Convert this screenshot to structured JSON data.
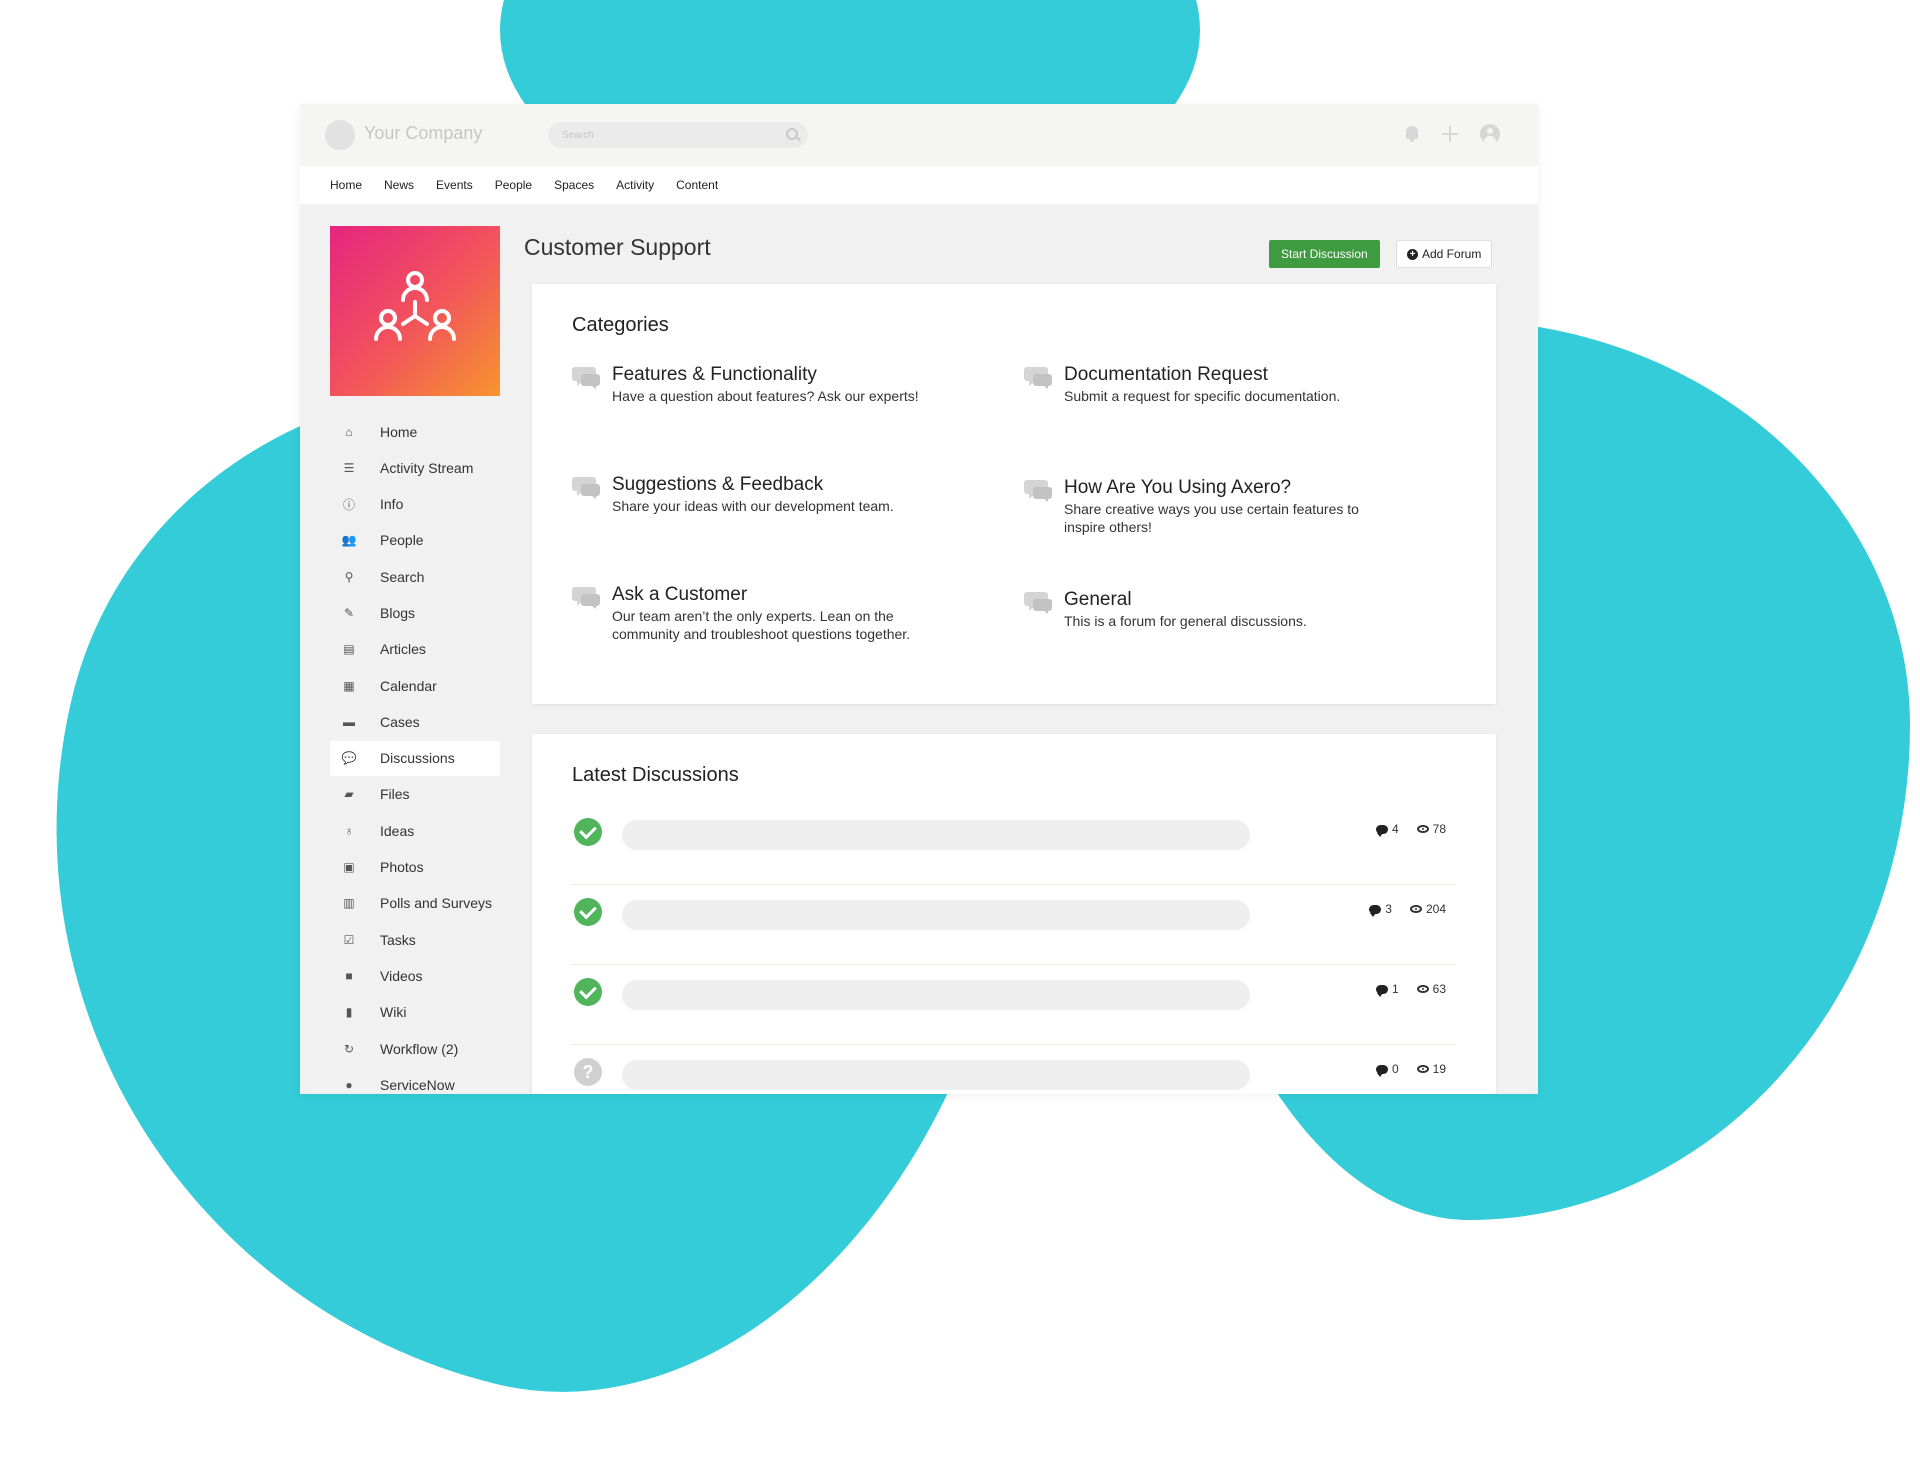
{
  "header": {
    "company_name": "Your Company",
    "search_placeholder": "Search",
    "icons": [
      "bell-icon",
      "plus-icon",
      "user-icon"
    ]
  },
  "nav": [
    "Home",
    "News",
    "Events",
    "People",
    "Spaces",
    "Activity",
    "Content"
  ],
  "sidebar": {
    "active_item": "Discussions",
    "items": [
      {
        "label": "Home",
        "icon": "home-icon"
      },
      {
        "label": "Activity Stream",
        "icon": "list-icon"
      },
      {
        "label": "Info",
        "icon": "info-icon"
      },
      {
        "label": "People",
        "icon": "users-icon"
      },
      {
        "label": "Search",
        "icon": "search-icon"
      },
      {
        "label": "Blogs",
        "icon": "blog-icon"
      },
      {
        "label": "Articles",
        "icon": "file-icon"
      },
      {
        "label": "Calendar",
        "icon": "calendar-icon"
      },
      {
        "label": "Cases",
        "icon": "briefcase-icon"
      },
      {
        "label": "Discussions",
        "icon": "comments-icon"
      },
      {
        "label": "Files",
        "icon": "folder-icon"
      },
      {
        "label": "Ideas",
        "icon": "lightbulb-icon"
      },
      {
        "label": "Photos",
        "icon": "image-icon"
      },
      {
        "label": "Polls and Surveys",
        "icon": "chart-icon"
      },
      {
        "label": "Tasks",
        "icon": "check-square-icon"
      },
      {
        "label": "Videos",
        "icon": "video-icon"
      },
      {
        "label": "Wiki",
        "icon": "book-icon"
      },
      {
        "label": "Workflow (2)",
        "icon": "refresh-icon"
      },
      {
        "label": "ServiceNow",
        "icon": "circle-icon"
      }
    ]
  },
  "page": {
    "title": "Customer Support",
    "start_button": "Start Discussion",
    "add_button": "Add Forum"
  },
  "categories": {
    "title": "Categories",
    "items": [
      {
        "name": "Features & Functionality",
        "description": "Have a question about features? Ask our experts!"
      },
      {
        "name": "Documentation Request",
        "description": "Submit a request for specific documentation."
      },
      {
        "name": "Suggestions & Feedback",
        "description": "Share your ideas with our development team."
      },
      {
        "name": "How Are You Using Axero?",
        "description": "Share creative ways you use certain features to inspire others!"
      },
      {
        "name": "Ask a Customer",
        "description": "Our team aren’t the only experts. Lean on the community and troubleshoot questions together."
      },
      {
        "name": "General",
        "description": "This is a forum for general discussions."
      }
    ]
  },
  "latest": {
    "title": "Latest Discussions",
    "items": [
      {
        "status": "solved",
        "comments": "4",
        "views": "78"
      },
      {
        "status": "solved",
        "comments": "3",
        "views": "204"
      },
      {
        "status": "solved",
        "comments": "1",
        "views": "63"
      },
      {
        "status": "unanswered",
        "comments": "0",
        "views": "19"
      }
    ]
  },
  "colors": {
    "background_blob": "#33CCD8",
    "primary_button": "#3e9b3f",
    "logo_gradient_start": "#e6247f",
    "logo_gradient_end": "#f8952f"
  }
}
